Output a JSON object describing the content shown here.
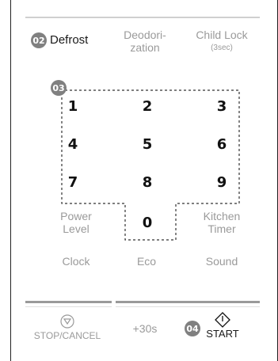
{
  "top_row": {
    "defrost_badge": "02",
    "defrost": "Defrost",
    "deodor_line1": "Deodori-",
    "deodor_line2": "zation",
    "childlock": "Child Lock",
    "childlock_sub": "(3sec)"
  },
  "keypad": {
    "badge": "03",
    "keys": [
      "1",
      "2",
      "3",
      "4",
      "5",
      "6",
      "7",
      "8",
      "9",
      "0"
    ]
  },
  "side": {
    "power_1": "Power",
    "power_2": "Level",
    "kitchen_1": "Kitchen",
    "kitchen_2": "Timer",
    "clock": "Clock",
    "eco": "Eco",
    "sound": "Sound"
  },
  "bottom": {
    "stop": "STOP/CANCEL",
    "plus30": "+30s",
    "start_badge": "04",
    "start": "START"
  },
  "colors": {
    "badge": "#808080",
    "gray_text": "#9a9a9a",
    "dashed": "#333333"
  }
}
